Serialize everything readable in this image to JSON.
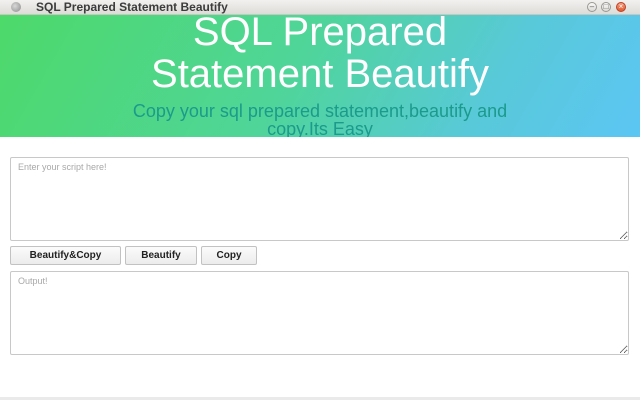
{
  "window": {
    "title": "SQL Prepared Statement Beautify",
    "controls": {
      "minimize": "–",
      "maximize": "□",
      "close": "×"
    }
  },
  "header": {
    "title_line1": "SQL Prepared",
    "title_line2": "Statement Beautify",
    "subtitle_line1": "Copy your sql prepared statement,beautify and",
    "subtitle_line2": "copy.Its Easy"
  },
  "input": {
    "placeholder": "Enter your script here!",
    "value": ""
  },
  "buttons": {
    "beautify_copy": "Beautify&Copy",
    "beautify": "Beautify",
    "copy": "Copy"
  },
  "output": {
    "placeholder": "Output!",
    "value": ""
  },
  "colors": {
    "gradient_start": "#4ed96a",
    "gradient_end": "#5cc6f4",
    "subtitle": "#1c9a8c"
  }
}
